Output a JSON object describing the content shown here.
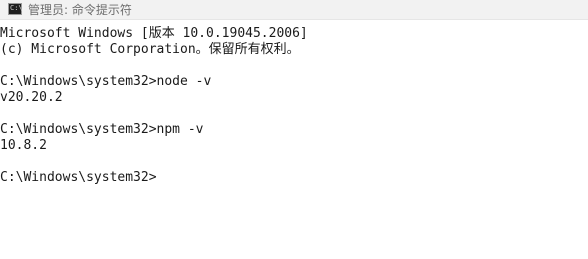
{
  "window": {
    "title": "管理员: 命令提示符",
    "icon": "cmd-icon",
    "icon_glyph": "C:\\"
  },
  "console": {
    "lines": [
      "Microsoft Windows [版本 10.0.19045.2006]",
      "(c) Microsoft Corporation。保留所有权利。",
      "",
      "C:\\Windows\\system32>node -v",
      "v20.20.2",
      "",
      "C:\\Windows\\system32>npm -v",
      "10.8.2",
      "",
      "C:\\Windows\\system32>"
    ]
  }
}
